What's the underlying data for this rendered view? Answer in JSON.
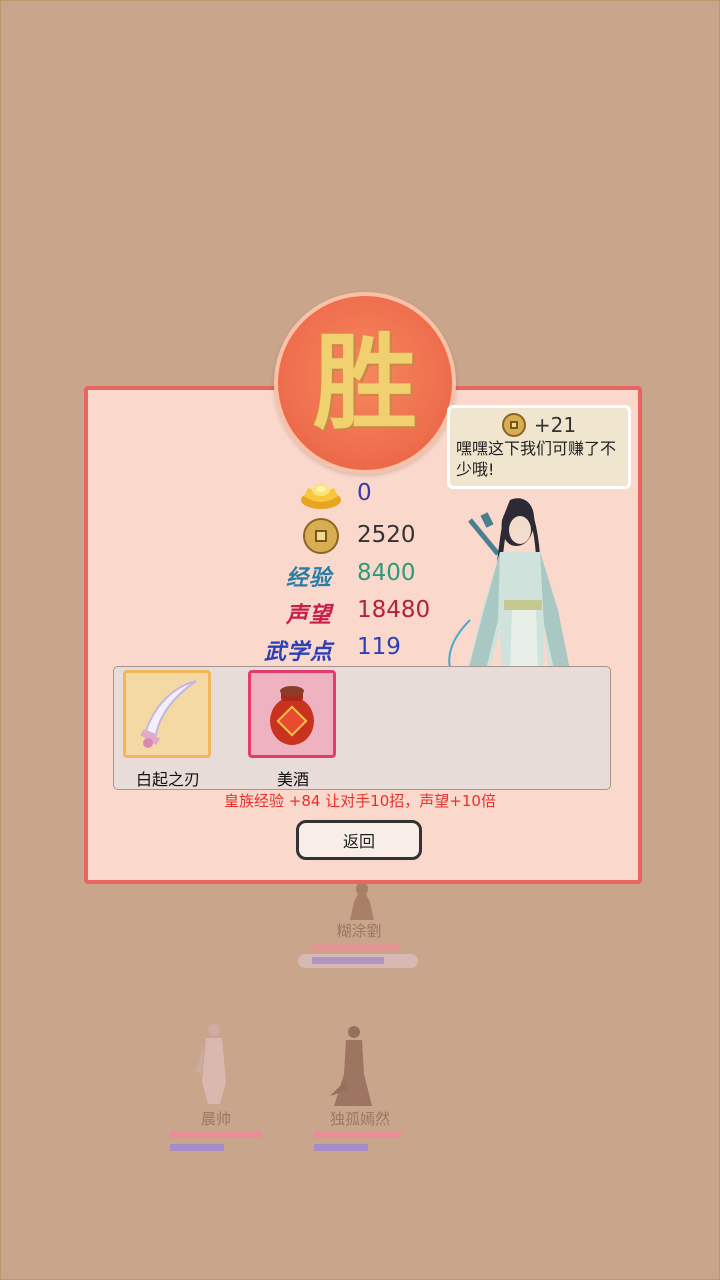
{
  "dialog": {
    "win_glyph": "胜",
    "speech": {
      "amount": "+21",
      "text": "嘿嘿这下我们可赚了不少哦!"
    },
    "stats": {
      "ingot_value": "0",
      "coin_value": "2520",
      "exp_label": "经验",
      "exp_value": "8400",
      "fame_label": "声望",
      "fame_value": "18480",
      "martial_label": "武学点",
      "martial_value": "119"
    },
    "items": [
      {
        "name": "白起之刃",
        "icon": "saber-icon"
      },
      {
        "name": "美酒",
        "icon": "wine-jar-icon"
      }
    ],
    "bonus_text": "皇族经验 +84 让对手10招，声望+10倍",
    "back_label": "返回"
  },
  "background_units": [
    {
      "name": "糊涂劉"
    },
    {
      "name": "晨帅"
    },
    {
      "name": "独孤嫣然"
    }
  ],
  "colors": {
    "background": "#c9a58b",
    "dialog_bg": "#fbd8cc",
    "dialog_border": "#e8665f",
    "exp": "#2e9a7a",
    "fame": "#b4213a",
    "martial": "#2b3fb8",
    "ingot_value": "#3a3aa8",
    "bonus": "#e6312d"
  }
}
